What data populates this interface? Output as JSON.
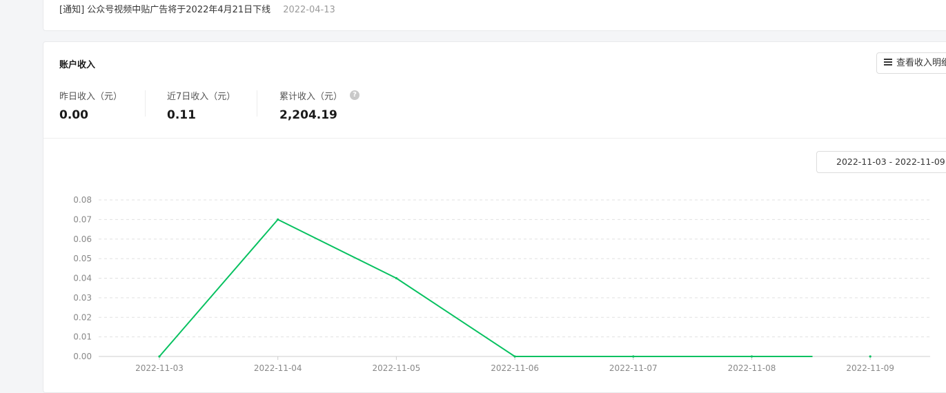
{
  "notice": {
    "text": "[通知] 公众号视频中贴广告将于2022年4月21日下线",
    "date": "2022-04-13"
  },
  "income": {
    "title": "账户收入",
    "detail_button": "查看收入明细",
    "stats": [
      {
        "label": "昨日收入（元）",
        "value": "0.00"
      },
      {
        "label": "近7日收入（元）",
        "value": "0.11"
      },
      {
        "label": "累计收入（元）",
        "value": "2,204.19"
      }
    ],
    "help_icon": "question-circle-icon",
    "date_range": "2022-11-03 - 2022-11-09",
    "calendar_icon": "calendar-icon"
  },
  "colors": {
    "line": "#07c160",
    "grid": "#e0e0e0",
    "axis_text": "#888888"
  },
  "chart_data": {
    "type": "line",
    "x": [
      "2022-11-03",
      "2022-11-04",
      "2022-11-05",
      "2022-11-06",
      "2022-11-07",
      "2022-11-08",
      "2022-11-09"
    ],
    "yticks": [
      "0.00",
      "0.01",
      "0.02",
      "0.03",
      "0.04",
      "0.05",
      "0.06",
      "0.07",
      "0.08"
    ],
    "ylim": [
      0,
      0.08
    ],
    "series": [
      {
        "values": [
          0.0,
          0.07,
          0.04,
          0.0,
          0.0,
          0.0,
          0.0
        ]
      }
    ],
    "grid": true
  }
}
